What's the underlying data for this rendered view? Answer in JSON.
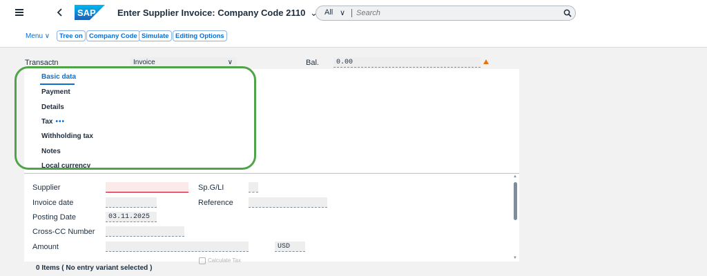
{
  "shell": {
    "logo_text": "SAP",
    "title": "Enter Supplier Invoice: Company Code 2110",
    "title_chevron": "⌄",
    "search_scope": "All",
    "search_scope_chevron": "∨",
    "search_placeholder": "Search",
    "brand_color": "#0a6ed1"
  },
  "toolbar": {
    "menu_label": "Menu ∨",
    "buttons": [
      "Tree on",
      "Company Code",
      "Simulate",
      "Editing Options"
    ]
  },
  "header": {
    "transaction_label": "Transactn",
    "transaction_value": "Invoice",
    "transaction_chevron": "∨",
    "balance_label": "Bal.",
    "balance_value": "0.00",
    "warning_icon": "warning-triangle-icon",
    "warning_color": "#e9730c"
  },
  "tabs": {
    "items": [
      "Basic data",
      "Payment",
      "Details",
      "Tax",
      "Withholding tax",
      "Notes",
      "Local currency"
    ],
    "selected": "Basic data",
    "more_indicator": "•••"
  },
  "form": {
    "supplier_label": "Supplier",
    "supplier_value": "",
    "spgl_label": "Sp.G/LI",
    "spgl_value": "",
    "invoice_date_label": "Invoice date",
    "invoice_date_value": "",
    "reference_label": "Reference",
    "reference_value": "",
    "posting_date_label": "Posting Date",
    "posting_date_value": "03.11.2025",
    "crosscc_label": "Cross-CC Number",
    "crosscc_value": "",
    "amount_label": "Amount",
    "amount_value": "",
    "currency_value": "USD",
    "calculate_tax_label": "Calculate Tax"
  },
  "footer": {
    "items_text": "0 Items ( No entry variant selected )"
  }
}
